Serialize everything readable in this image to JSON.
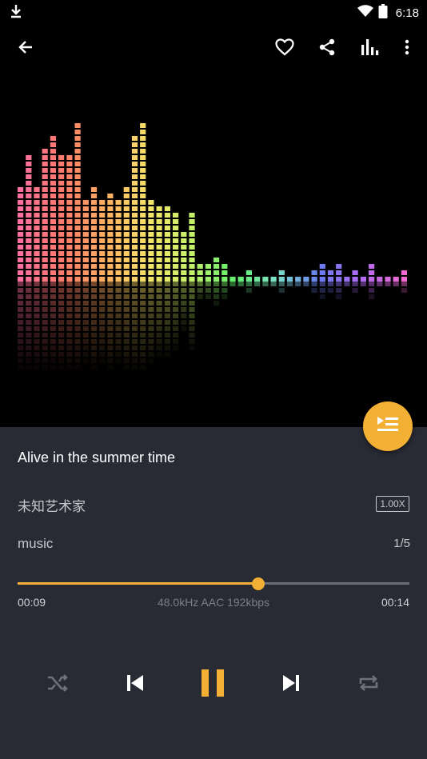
{
  "status_bar": {
    "time": "6:18",
    "icons": [
      "download-icon",
      "wifi-icon",
      "battery-icon"
    ]
  },
  "toolbar": {
    "icons": [
      "back-arrow-icon",
      "heart-icon",
      "share-icon",
      "equalizer-icon",
      "more-vert-icon"
    ]
  },
  "visualizer": {
    "levels": [
      0.58,
      0.78,
      0.58,
      0.8,
      0.86,
      0.78,
      0.75,
      0.96,
      0.5,
      0.58,
      0.5,
      0.54,
      0.5,
      0.56,
      0.88,
      0.96,
      0.48,
      0.45,
      0.46,
      0.4,
      0.3,
      0.4,
      0.12,
      0.1,
      0.16,
      0.1,
      0.04,
      0.04,
      0.06,
      0.0,
      0.04,
      0.02,
      0.08,
      0.0,
      0.02,
      0.0,
      0.06,
      0.12,
      0.06,
      0.12,
      0.02,
      0.06,
      0.04,
      0.1,
      0.04,
      0.02,
      0.0,
      0.06
    ],
    "colors": [
      "#ff6fa0",
      "#ff7a6a",
      "#ffb060",
      "#f6e36a",
      "#c6f06a",
      "#62f06a",
      "#7ce0c8",
      "#6a7cf0",
      "#b06af0",
      "#f06ad0"
    ]
  },
  "queue_button": {
    "icon": "playlist-icon"
  },
  "track": {
    "title": "Alive in the summer time",
    "artist": "未知艺术家",
    "speed": "1.00X",
    "album": "music",
    "position": "1/5"
  },
  "progress": {
    "current": "00:09",
    "duration": "00:14",
    "info": "48.0kHz AAC 192kbps",
    "fraction": 0.615,
    "accent": "#f2b134"
  },
  "controls": {
    "icons": [
      "shuffle-icon",
      "previous-icon",
      "pause-icon",
      "next-icon",
      "repeat-icon"
    ]
  }
}
